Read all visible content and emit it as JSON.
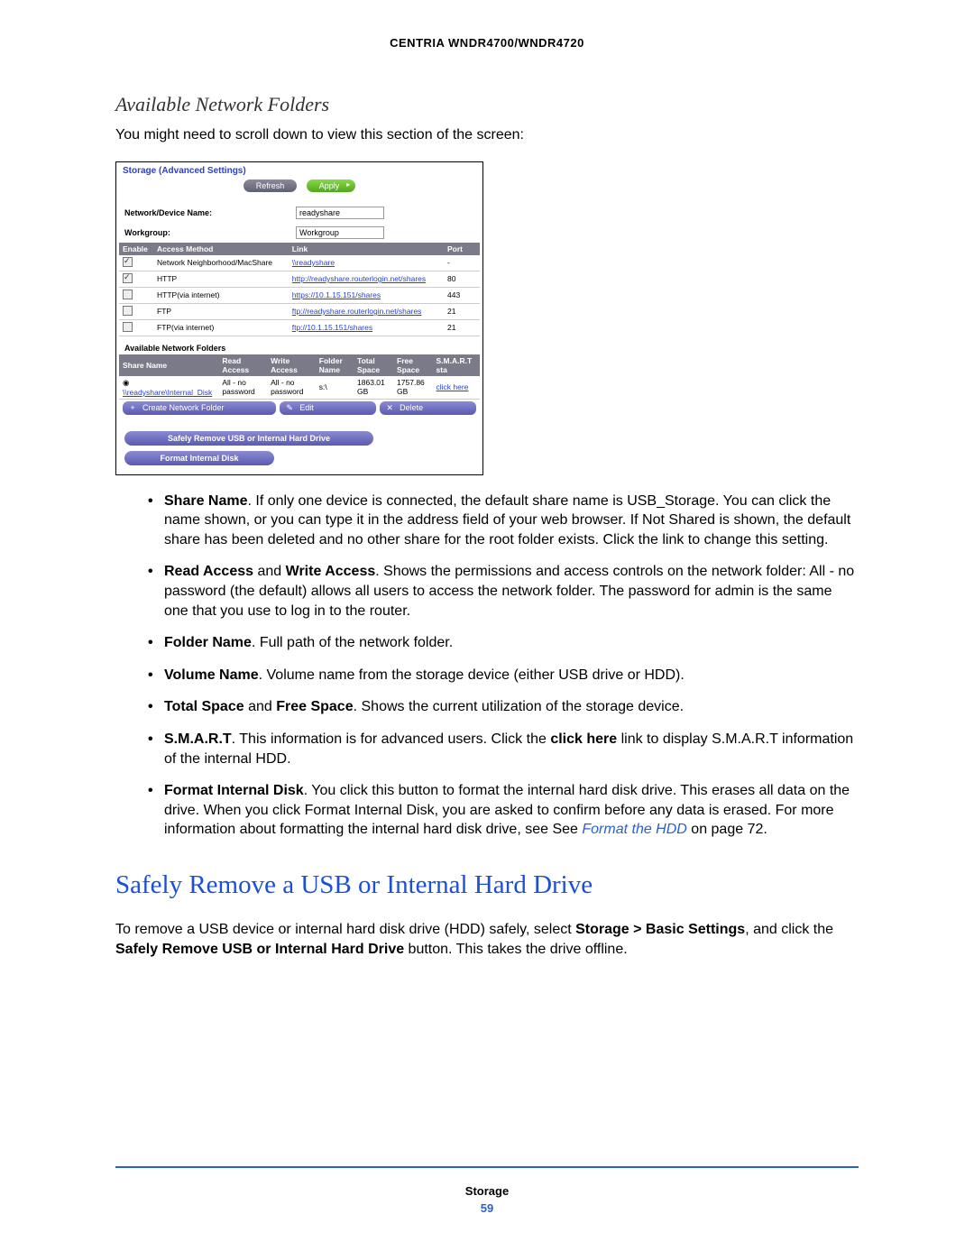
{
  "header": {
    "title": "CENTRIA WNDR4700/WNDR4720"
  },
  "section1": {
    "heading": "Available Network Folders",
    "intro": "You might need to scroll down to view this section of the screen:"
  },
  "screenshot": {
    "title": "Storage (Advanced Settings)",
    "buttons": {
      "refresh": "Refresh",
      "apply": "Apply"
    },
    "fields": {
      "devname_label": "Network/Device Name:",
      "devname_value": "readyshare",
      "workgroup_label": "Workgroup:",
      "workgroup_value": "Workgroup"
    },
    "access_table": {
      "cols": [
        "Enable",
        "Access Method",
        "Link",
        "Port"
      ],
      "rows": [
        {
          "enabled": true,
          "method": "Network Neighborhood/MacShare",
          "link": "\\\\readyshare",
          "port": "-"
        },
        {
          "enabled": true,
          "method": "HTTP",
          "link": "http://readyshare.routerlogin.net/shares",
          "port": "80"
        },
        {
          "enabled": false,
          "method": "HTTP(via internet)",
          "link": "https://10.1.15.151/shares",
          "port": "443"
        },
        {
          "enabled": false,
          "method": "FTP",
          "link": "ftp://readyshare.routerlogin.net/shares",
          "port": "21"
        },
        {
          "enabled": false,
          "method": "FTP(via internet)",
          "link": "ftp://10.1.15.151/shares",
          "port": "21"
        }
      ]
    },
    "folders": {
      "heading": "Available Network Folders",
      "cols": [
        "Share Name",
        "Read Access",
        "Write Access",
        "Folder Name",
        "Total Space",
        "Free Space",
        "S.M.A.R.T sta"
      ],
      "row": {
        "share": "\\\\readyshare\\Internal_Disk",
        "read": "All - no password",
        "write": "All - no password",
        "folder": "s:\\",
        "total": "1863.01 GB",
        "free": "1757.86 GB",
        "smart": "click here"
      }
    },
    "action_btns": {
      "create": "Create Network Folder",
      "edit": "Edit",
      "delete": "Delete"
    },
    "big_btns": {
      "remove": "Safely Remove USB or Internal Hard Drive",
      "format": "Format Internal Disk"
    }
  },
  "bullets": {
    "b1a": "Share Name",
    "b1b": ". If only one device is connected, the default share name is USB_Storage. You can click the name shown, or you can type it in the address field of your web browser. If Not Shared is shown, the default share has been deleted and no other share for the root folder exists. Click the link to change this setting.",
    "b2a": "Read Access",
    "b2b": " and ",
    "b2c": "Write Access",
    "b2d": ". Shows the permissions and access controls on the network folder: All - no password (the default) allows all users to access the network folder. The password for admin is the same one that you use to log in to the router.",
    "b3a": "Folder Name",
    "b3b": ". Full path of the network folder.",
    "b4a": "Volume Name",
    "b4b": ". Volume name from the storage device (either USB drive or HDD).",
    "b5a": "Total Space",
    "b5b": " and ",
    "b5c": "Free Space",
    "b5d": ". Shows the current utilization of the storage device.",
    "b6a": "S.M.A.R.T",
    "b6b": ". This information is for advanced users. Click the ",
    "b6c": "click here",
    "b6d": " link to display S.M.A.R.T information of the internal HDD.",
    "b7a": "Format Internal Disk",
    "b7b": ". You click this button to format the internal hard disk drive. This erases all data on the drive. When you click Format Internal Disk, you are asked to confirm before any data is erased. For more information about formatting the internal hard disk drive, see See ",
    "b7c": "Format the HDD",
    "b7d": " on page 72."
  },
  "section2": {
    "heading": "Safely Remove a USB or Internal Hard Drive",
    "p1a": "To remove a USB device or internal hard disk drive (HDD) safely, select ",
    "p1b": "Storage > Basic Settings",
    "p1c": ", and click the ",
    "p1d": "Safely Remove USB or Internal Hard Drive",
    "p1e": " button. This takes the drive offline."
  },
  "footer": {
    "label": "Storage",
    "page": "59"
  }
}
